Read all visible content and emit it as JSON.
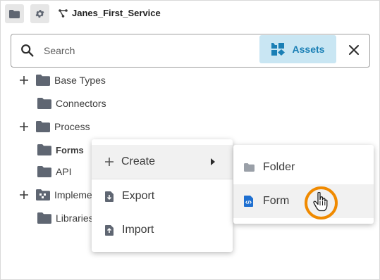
{
  "toolbar": {
    "service_name": "Janes_First_Service"
  },
  "search": {
    "placeholder": "Search",
    "assets_label": "Assets"
  },
  "tree": {
    "items": [
      {
        "label": "Base Types",
        "expandable": true,
        "bold": false
      },
      {
        "label": "Connectors",
        "expandable": false,
        "bold": false
      },
      {
        "label": "Process",
        "expandable": true,
        "bold": false
      },
      {
        "label": "Forms",
        "expandable": false,
        "bold": true
      },
      {
        "label": "API",
        "expandable": false,
        "bold": false
      },
      {
        "label": "Impleme",
        "expandable": true,
        "bold": false
      },
      {
        "label": "Libraries",
        "expandable": false,
        "bold": false
      }
    ]
  },
  "context_menu": {
    "create": "Create",
    "export": "Export",
    "import": "Import"
  },
  "submenu": {
    "folder": "Folder",
    "form": "Form"
  },
  "colors": {
    "accent": "#1a7fb5",
    "assets_bg": "#c9e6f3",
    "highlight_ring": "#f08a00",
    "folder_icon": "#5f6672"
  }
}
